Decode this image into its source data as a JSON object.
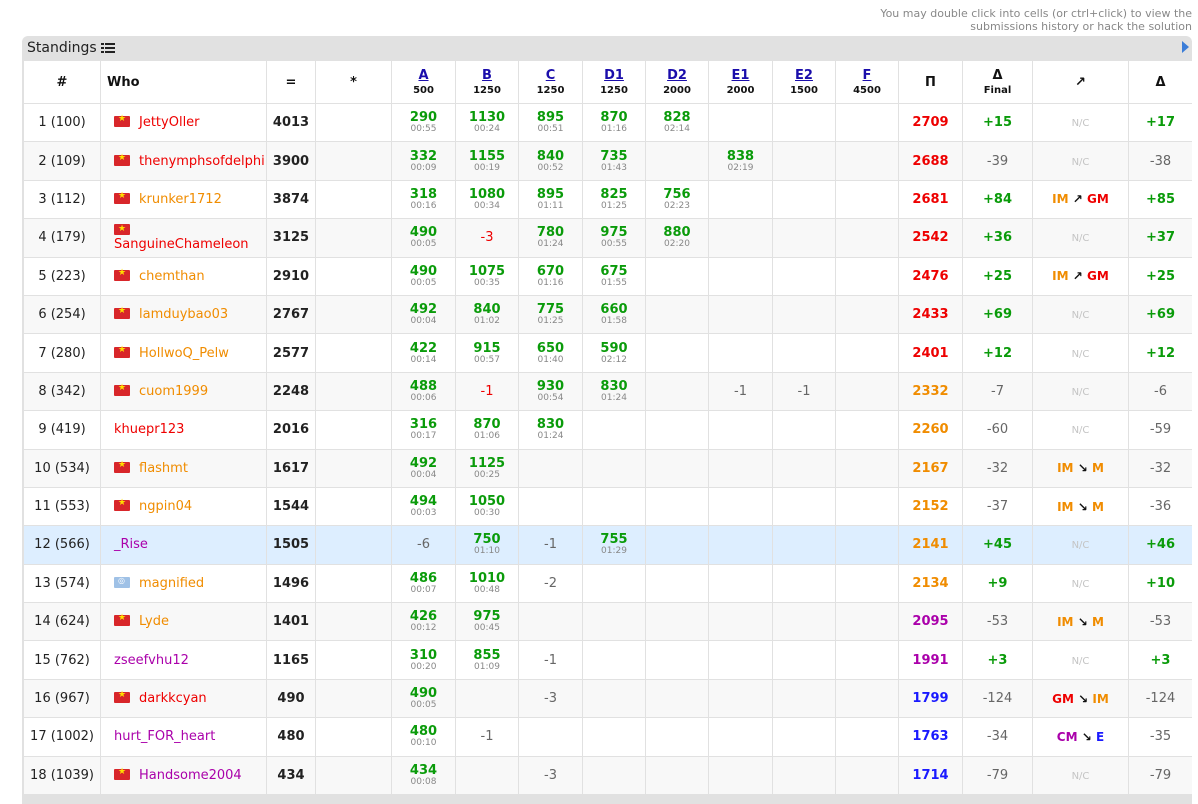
{
  "hint": "You may double click into cells (or ctrl+click) to view the submissions history or hack the solution",
  "caption": "Standings",
  "header": {
    "rank": "#",
    "who": "Who",
    "points": "=",
    "hacks": "*",
    "problems": [
      {
        "label": "A",
        "score": "500"
      },
      {
        "label": "B",
        "score": "1250"
      },
      {
        "label": "C",
        "score": "1250"
      },
      {
        "label": "D1",
        "score": "1250"
      },
      {
        "label": "D2",
        "score": "2000"
      },
      {
        "label": "E1",
        "score": "2000"
      },
      {
        "label": "E2",
        "score": "1500"
      },
      {
        "label": "F",
        "score": "4500"
      }
    ],
    "perf": "Π",
    "delta_final": "Δ",
    "final_label": "Final",
    "rank_change": "↗",
    "delta": "Δ"
  },
  "rows": [
    {
      "rank": "1 (100)",
      "flag": "vn",
      "name": "JettyOller",
      "name_color": "red",
      "points": "4013",
      "cells": [
        {
          "v": "290",
          "t": "00:55"
        },
        {
          "v": "1130",
          "t": "00:24"
        },
        {
          "v": "895",
          "t": "00:51"
        },
        {
          "v": "870",
          "t": "01:16"
        },
        {
          "v": "828",
          "t": "02:14"
        },
        {},
        {},
        {}
      ],
      "perf": "2709",
      "perf_color": "red",
      "df": "+15",
      "tier": "N/C",
      "d2": "+17"
    },
    {
      "rank": "2 (109)",
      "flag": "vn",
      "name": "thenymphsofdelphi",
      "name_color": "red",
      "points": "3900",
      "cells": [
        {
          "v": "332",
          "t": "00:09"
        },
        {
          "v": "1155",
          "t": "00:19"
        },
        {
          "v": "840",
          "t": "00:52"
        },
        {
          "v": "735",
          "t": "01:43"
        },
        {},
        {
          "v": "838",
          "t": "02:19"
        },
        {},
        {}
      ],
      "perf": "2688",
      "perf_color": "red",
      "df": "-39",
      "tier": "N/C",
      "d2": "-38"
    },
    {
      "rank": "3 (112)",
      "flag": "vn",
      "name": "krunker1712",
      "name_color": "orange",
      "points": "3874",
      "cells": [
        {
          "v": "318",
          "t": "00:16"
        },
        {
          "v": "1080",
          "t": "00:34"
        },
        {
          "v": "895",
          "t": "01:11"
        },
        {
          "v": "825",
          "t": "01:25"
        },
        {
          "v": "756",
          "t": "02:23"
        },
        {},
        {},
        {}
      ],
      "perf": "2681",
      "perf_color": "red",
      "df": "+84",
      "tier_from": "IM",
      "tier_from_color": "orange",
      "tier_arrow": "↗",
      "tier_to": "GM",
      "tier_to_color": "red",
      "d2": "+85"
    },
    {
      "rank": "4 (179)",
      "flag": "vn",
      "stack": true,
      "name": "SanguineChameleon",
      "name_color": "red",
      "points": "3125",
      "cells": [
        {
          "v": "490",
          "t": "00:05"
        },
        {
          "r": "-3",
          "red": true
        },
        {
          "v": "780",
          "t": "01:24"
        },
        {
          "v": "975",
          "t": "00:55"
        },
        {
          "v": "880",
          "t": "02:20"
        },
        {},
        {},
        {}
      ],
      "perf": "2542",
      "perf_color": "red",
      "df": "+36",
      "tier": "N/C",
      "d2": "+37"
    },
    {
      "rank": "5 (223)",
      "flag": "vn",
      "name": "chemthan",
      "name_color": "orange",
      "points": "2910",
      "cells": [
        {
          "v": "490",
          "t": "00:05"
        },
        {
          "v": "1075",
          "t": "00:35"
        },
        {
          "v": "670",
          "t": "01:16"
        },
        {
          "v": "675",
          "t": "01:55"
        },
        {},
        {},
        {},
        {}
      ],
      "perf": "2476",
      "perf_color": "red",
      "df": "+25",
      "tier_from": "IM",
      "tier_from_color": "orange",
      "tier_arrow": "↗",
      "tier_to": "GM",
      "tier_to_color": "red",
      "d2": "+25"
    },
    {
      "rank": "6 (254)",
      "flag": "vn",
      "name": "lamduybao03",
      "name_color": "orange",
      "points": "2767",
      "cells": [
        {
          "v": "492",
          "t": "00:04"
        },
        {
          "v": "840",
          "t": "01:02"
        },
        {
          "v": "775",
          "t": "01:25"
        },
        {
          "v": "660",
          "t": "01:58"
        },
        {},
        {},
        {},
        {}
      ],
      "perf": "2433",
      "perf_color": "red",
      "df": "+69",
      "tier": "N/C",
      "d2": "+69"
    },
    {
      "rank": "7 (280)",
      "flag": "vn",
      "name": "HollwoQ_Pelw",
      "name_color": "orange",
      "points": "2577",
      "cells": [
        {
          "v": "422",
          "t": "00:14"
        },
        {
          "v": "915",
          "t": "00:57"
        },
        {
          "v": "650",
          "t": "01:40"
        },
        {
          "v": "590",
          "t": "02:12"
        },
        {},
        {},
        {},
        {}
      ],
      "perf": "2401",
      "perf_color": "red",
      "df": "+12",
      "tier": "N/C",
      "d2": "+12"
    },
    {
      "rank": "8 (342)",
      "flag": "vn",
      "name": "cuom1999",
      "name_color": "orange",
      "points": "2248",
      "cells": [
        {
          "v": "488",
          "t": "00:06"
        },
        {
          "r": "-1",
          "red": true
        },
        {
          "v": "930",
          "t": "00:54"
        },
        {
          "v": "830",
          "t": "01:24"
        },
        {},
        {
          "r": "-1"
        },
        {
          "r": "-1"
        },
        {}
      ],
      "perf": "2332",
      "perf_color": "orange",
      "df": "-7",
      "tier": "N/C",
      "d2": "-6"
    },
    {
      "rank": "9 (419)",
      "flag": "",
      "name": "khuepr123",
      "name_color": "red",
      "points": "2016",
      "cells": [
        {
          "v": "316",
          "t": "00:17"
        },
        {
          "v": "870",
          "t": "01:06"
        },
        {
          "v": "830",
          "t": "01:24"
        },
        {},
        {},
        {},
        {},
        {}
      ],
      "perf": "2260",
      "perf_color": "orange",
      "df": "-60",
      "tier": "N/C",
      "d2": "-59"
    },
    {
      "rank": "10 (534)",
      "flag": "vn",
      "name": "flashmt",
      "name_color": "orange",
      "points": "1617",
      "cells": [
        {
          "v": "492",
          "t": "00:04"
        },
        {
          "v": "1125",
          "t": "00:25"
        },
        {},
        {},
        {},
        {},
        {},
        {}
      ],
      "perf": "2167",
      "perf_color": "orange",
      "df": "-32",
      "tier_from": "IM",
      "tier_from_color": "orange",
      "tier_arrow": "↘",
      "tier_to": "M",
      "tier_to_color": "orange",
      "d2": "-32"
    },
    {
      "rank": "11 (553)",
      "flag": "vn",
      "name": "ngpin04",
      "name_color": "orange",
      "points": "1544",
      "cells": [
        {
          "v": "494",
          "t": "00:03"
        },
        {
          "v": "1050",
          "t": "00:30"
        },
        {},
        {},
        {},
        {},
        {},
        {}
      ],
      "perf": "2152",
      "perf_color": "orange",
      "df": "-37",
      "tier_from": "IM",
      "tier_from_color": "orange",
      "tier_arrow": "↘",
      "tier_to": "M",
      "tier_to_color": "orange",
      "d2": "-36"
    },
    {
      "rank": "12 (566)",
      "flag": "",
      "name": "_Rise",
      "name_color": "violet",
      "points": "1505",
      "highlight": true,
      "cells": [
        {
          "r": "-6"
        },
        {
          "v": "750",
          "t": "01:10"
        },
        {
          "r": "-1"
        },
        {
          "v": "755",
          "t": "01:29"
        },
        {},
        {},
        {},
        {}
      ],
      "perf": "2141",
      "perf_color": "orange",
      "df": "+45",
      "tier": "N/C",
      "d2": "+46"
    },
    {
      "rank": "13 (574)",
      "flag": "un",
      "name": "magnified",
      "name_color": "orange",
      "points": "1496",
      "cells": [
        {
          "v": "486",
          "t": "00:07"
        },
        {
          "v": "1010",
          "t": "00:48"
        },
        {
          "r": "-2"
        },
        {},
        {},
        {},
        {},
        {}
      ],
      "perf": "2134",
      "perf_color": "orange",
      "df": "+9",
      "tier": "N/C",
      "d2": "+10"
    },
    {
      "rank": "14 (624)",
      "flag": "vn",
      "name": "Lyde",
      "name_color": "orange",
      "points": "1401",
      "cells": [
        {
          "v": "426",
          "t": "00:12"
        },
        {
          "v": "975",
          "t": "00:45"
        },
        {},
        {},
        {},
        {},
        {},
        {}
      ],
      "perf": "2095",
      "perf_color": "violet",
      "df": "-53",
      "tier_from": "IM",
      "tier_from_color": "orange",
      "tier_arrow": "↘",
      "tier_to": "M",
      "tier_to_color": "orange",
      "d2": "-53"
    },
    {
      "rank": "15 (762)",
      "flag": "",
      "name": "zseefvhu12",
      "name_color": "violet",
      "points": "1165",
      "cells": [
        {
          "v": "310",
          "t": "00:20"
        },
        {
          "v": "855",
          "t": "01:09"
        },
        {
          "r": "-1"
        },
        {},
        {},
        {},
        {},
        {}
      ],
      "perf": "1991",
      "perf_color": "violet",
      "df": "+3",
      "tier": "N/C",
      "d2": "+3"
    },
    {
      "rank": "16 (967)",
      "flag": "vn",
      "name": "darkkcyan",
      "name_color": "red",
      "points": "490",
      "cells": [
        {
          "v": "490",
          "t": "00:05"
        },
        {},
        {
          "r": "-3"
        },
        {},
        {},
        {},
        {},
        {}
      ],
      "perf": "1799",
      "perf_color": "blue",
      "df": "-124",
      "tier_from": "GM",
      "tier_from_color": "red",
      "tier_arrow": "↘",
      "tier_to": "IM",
      "tier_to_color": "orange",
      "d2": "-124"
    },
    {
      "rank": "17 (1002)",
      "flag": "",
      "name": "hurt_FOR_heart",
      "name_color": "violet",
      "points": "480",
      "cells": [
        {
          "v": "480",
          "t": "00:10"
        },
        {
          "r": "-1"
        },
        {},
        {},
        {},
        {},
        {},
        {}
      ],
      "perf": "1763",
      "perf_color": "blue",
      "df": "-34",
      "tier_from": "CM",
      "tier_from_color": "violet",
      "tier_arrow": "↘",
      "tier_to": "E",
      "tier_to_color": "blue",
      "d2": "-35"
    },
    {
      "rank": "18 (1039)",
      "flag": "vn",
      "name": "Handsome2004",
      "name_color": "violet",
      "points": "434",
      "cells": [
        {
          "v": "434",
          "t": "00:08"
        },
        {},
        {
          "r": "-3"
        },
        {},
        {},
        {},
        {},
        {}
      ],
      "perf": "1714",
      "perf_color": "blue",
      "df": "-79",
      "tier": "N/C",
      "d2": "-79"
    }
  ],
  "colors": {
    "accepted": "#0a9b0a",
    "red": "#ee0000",
    "orange": "#f08c00",
    "violet": "#aa00aa",
    "blue": "#1a1aff",
    "highlight": "#ddeeff"
  }
}
